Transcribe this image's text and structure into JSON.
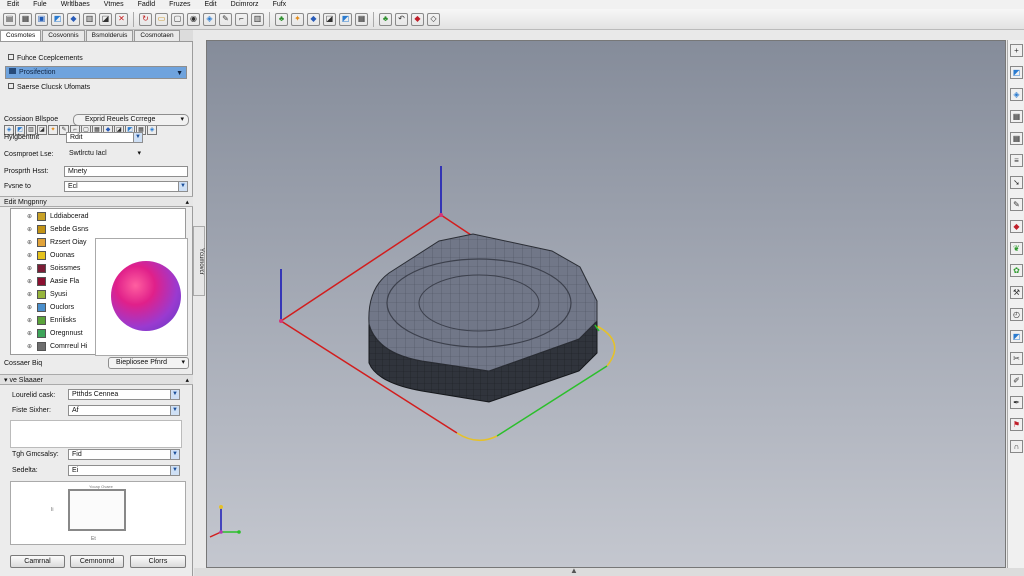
{
  "menu": [
    "Edit",
    "Fule",
    "Wrltlbaes",
    "Vtmes",
    "Fadld",
    "Fruzes",
    "Edit",
    "Dcimrorz",
    "Fufx"
  ],
  "toolbar": {
    "icons": [
      "file-icon",
      "document-icon",
      "save-icon",
      "image-icon",
      "cube-icon",
      "grid-icon",
      "graph-icon",
      "close-icon",
      "refresh-icon",
      "folder-icon",
      "screen-icon",
      "info-icon",
      "photo-icon",
      "tool-icon",
      "crop-icon",
      "grid-icon",
      "tree-icon",
      "render-icon",
      "cube-icon",
      "graph-icon",
      "image-icon",
      "document-icon",
      "tree-icon",
      "undo-icon",
      "gem-icon",
      "shape-icon"
    ]
  },
  "left_panel": {
    "tabs": [
      "Cosmotes",
      "Cosvonnis",
      "Bsmolderuis",
      "Cosmotaen"
    ],
    "header": "Fuhce Cceplcements",
    "preset_select": "Prosifection",
    "source_label": "Saerse Clucsk Ufomats",
    "creation_label": "Cossiaon Bllspoe",
    "creation_value": "Exprid Reuels Ccrrege",
    "highlight_label": "Hylgbentnit",
    "highlight_value": "Rdit",
    "component_label": "Cosmproet Lse:",
    "component_value": "Swtlrctu Iacl",
    "property_label": "Prosprth Hsst:",
    "property_value": "Mnety",
    "frame_label": "Fvsne to",
    "frame_value": "Ecl",
    "mapping_header": "Edit Mngpnny",
    "tree_items": [
      {
        "label": "Lddiabcerad",
        "color": "#c9a227"
      },
      {
        "label": "Sebde Gsns",
        "color": "#c29315"
      },
      {
        "label": "Rzsert Oiay",
        "color": "#e1a33a"
      },
      {
        "label": "Ouonas",
        "color": "#e5c21d"
      },
      {
        "label": "Soissmes",
        "color": "#7b1d36"
      },
      {
        "label": "Aasie Fla",
        "color": "#8b1030"
      },
      {
        "label": "Syusi",
        "color": "#97b53c"
      },
      {
        "label": "Ouclors",
        "color": "#4a8fcc"
      },
      {
        "label": "Enrilisks",
        "color": "#5aa33a"
      },
      {
        "label": "Oregnnust",
        "color": "#3ea55a"
      },
      {
        "label": "Comrreul Hi",
        "color": "#6e6e6e"
      }
    ],
    "curve_label": "Cossaer Biq",
    "curve_button": "Biepliosee Pfnrd",
    "shader_header": "ve Slaaaer",
    "fields": [
      {
        "label": "Lourelid cask:",
        "value": "Ptthds Cennea"
      },
      {
        "label": "Fiste Sixher:",
        "value": "Af"
      },
      {
        "label": "Tgh Gmcsalsy:",
        "value": "Fid"
      },
      {
        "label": "Sedelta:",
        "value": "Ei"
      }
    ],
    "frame_caption_top": "Yocap Ovaee",
    "frame_caption_left": "Ii",
    "frame_caption_bottom": "Et",
    "buttons": [
      "Camrnal",
      "Cemnonnd",
      "Clorrs"
    ]
  },
  "splitter_text": "Ycumovcr",
  "right_toolbar": {
    "icons": [
      "plus-icon",
      "image-icon",
      "photo-icon",
      "document-icon",
      "gallery-icon",
      "layers-icon",
      "arrow-icon",
      "tool-icon",
      "gem-icon",
      "leaf-icon",
      "plant-icon",
      "wrench-icon",
      "clock-icon",
      "image-icon",
      "scissors-icon",
      "brush-icon",
      "pen-icon",
      "flag-icon",
      "magnet-icon"
    ]
  },
  "colors": {
    "x_axis": "#2bbf2b",
    "y_axis": "#d21d1d",
    "z_axis": "#1a1ab8",
    "mesh_top": "#6e7384",
    "mesh_side": "#2c2f36"
  }
}
